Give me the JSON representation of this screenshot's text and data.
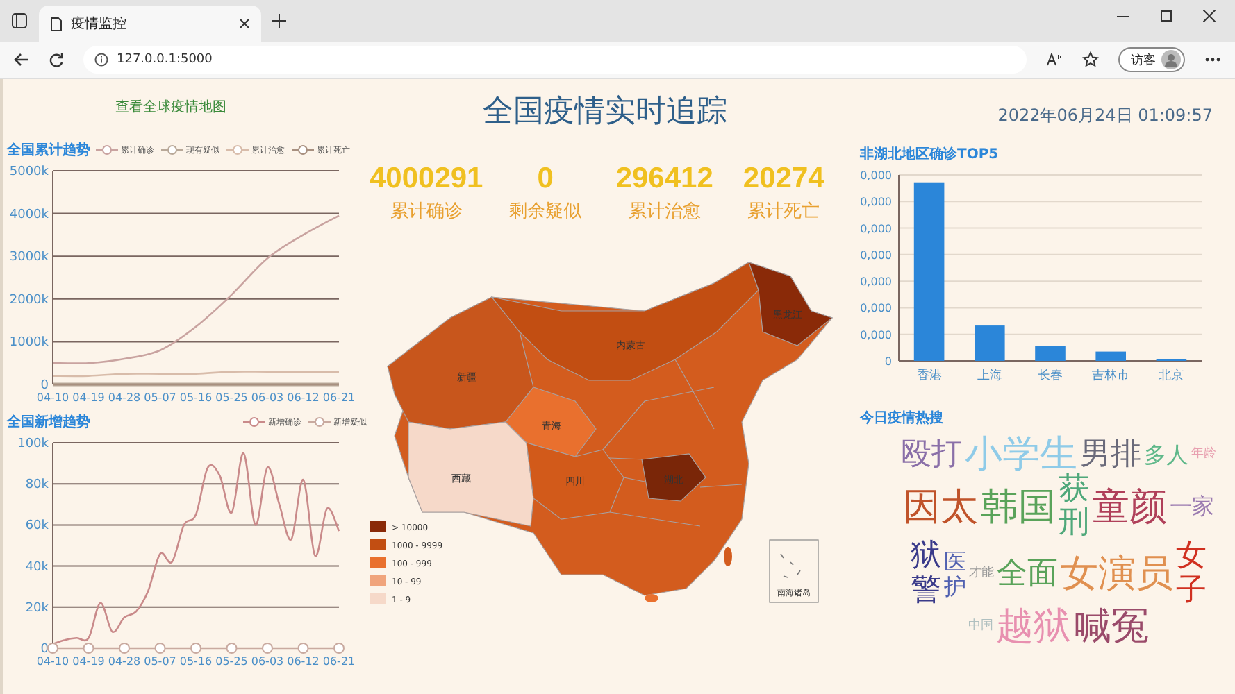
{
  "browser": {
    "tab_title": "疫情监控",
    "url": "127.0.0.1:5000",
    "profile_button": "访客"
  },
  "left": {
    "link": "查看全球疫情地图",
    "cumulative": {
      "title": "全国累计趋势",
      "chart_data": {
        "type": "line",
        "grid": true,
        "categories": [
          "04-10",
          "04-19",
          "04-28",
          "05-07",
          "05-16",
          "05-25",
          "06-03",
          "06-12",
          "06-21"
        ],
        "ylim": [
          0,
          5000
        ],
        "yticks": [
          {
            "value": 0,
            "label": "0"
          },
          {
            "value": 1000,
            "label": "1000k"
          },
          {
            "value": 2000,
            "label": "2000k"
          },
          {
            "value": 3000,
            "label": "3000k"
          },
          {
            "value": 4000,
            "label": "4000k"
          },
          {
            "value": 5000,
            "label": "5000k"
          }
        ],
        "series": [
          {
            "name": "累计确诊",
            "color": "#c9a3a0",
            "values": [
              500,
              500,
              600,
              800,
              1350,
              2100,
              2950,
              3500,
              3950
            ]
          },
          {
            "name": "现有疑似",
            "color": "#b8a898",
            "values": [
              0,
              0,
              0,
              0,
              0,
              0,
              0,
              0,
              0
            ]
          },
          {
            "name": "累计治愈",
            "color": "#d8bcaa",
            "values": [
              200,
              200,
              250,
              250,
              250,
              300,
              300,
              300,
              300
            ]
          },
          {
            "name": "累计死亡",
            "color": "#a89080",
            "values": [
              0,
              0,
              0,
              0,
              0,
              0,
              0,
              0,
              0
            ]
          }
        ]
      }
    },
    "new_cases": {
      "title": "全国新增趋势",
      "chart_data": {
        "type": "line",
        "grid": true,
        "categories": [
          "04-10",
          null,
          null,
          "04-19",
          null,
          null,
          "04-28",
          null,
          null,
          "05-07",
          null,
          null,
          "05-16",
          null,
          null,
          "05-25",
          null,
          null,
          "06-03",
          null,
          null,
          "06-12",
          null,
          null,
          "06-21"
        ],
        "ylim": [
          0,
          100
        ],
        "yticks": [
          {
            "value": 0,
            "label": "0"
          },
          {
            "value": 20,
            "label": "20k"
          },
          {
            "value": 40,
            "label": "40k"
          },
          {
            "value": 60,
            "label": "60k"
          },
          {
            "value": 80,
            "label": "80k"
          },
          {
            "value": 100,
            "label": "100k"
          }
        ],
        "series": [
          {
            "name": "新增确诊",
            "color": "#c98a8a",
            "values": [
              2,
              4,
              5,
              5,
              22,
              8,
              15,
              18,
              28,
              46,
              42,
              60,
              65,
              88,
              84,
              66,
              95,
              60,
              88,
              70,
              53,
              82,
              45,
              68,
              57
            ]
          },
          {
            "name": "新增疑似",
            "color": "#c9aaa0",
            "values": [
              0,
              0,
              0,
              0,
              0,
              0,
              0,
              0,
              0,
              0,
              0,
              0,
              0,
              0,
              0,
              0,
              0,
              0,
              0,
              0,
              0,
              0,
              0,
              0,
              0
            ]
          }
        ]
      }
    }
  },
  "center": {
    "title": "全国疫情实时追踪",
    "stats": [
      {
        "value": "4000291",
        "label": "累计确诊"
      },
      {
        "value": "0",
        "label": "剩余疑似"
      },
      {
        "value": "296412",
        "label": "累计治愈"
      },
      {
        "value": "20274",
        "label": "累计死亡"
      }
    ],
    "map": {
      "provinces": [
        {
          "name": "新疆",
          "color": "#c8561c"
        },
        {
          "name": "西藏",
          "color": "#f6d9c9"
        },
        {
          "name": "青海",
          "color": "#e9702e"
        },
        {
          "name": "内蒙古",
          "color": "#c24e12"
        },
        {
          "name": "黑龙江",
          "color": "#8a2a08"
        },
        {
          "name": "四川",
          "color": "#d25a1a"
        },
        {
          "name": "湖北",
          "color": "#7a2608"
        }
      ],
      "inset_label": "南海诸岛",
      "legend": [
        {
          "label": "> 10000",
          "color": "#8a2a08"
        },
        {
          "label": "1000 - 9999",
          "color": "#c24e12"
        },
        {
          "label": "100 - 999",
          "color": "#e9702e"
        },
        {
          "label": "10 - 99",
          "color": "#f0a47c"
        },
        {
          "label": "1 - 9",
          "color": "#f6d9c9"
        }
      ]
    }
  },
  "right": {
    "datetime": "2022年06月24日 01:09:57",
    "top5": {
      "title": "非湖北地区确诊TOP5",
      "bar_chart": {
        "y_axis_labels": [
          "0,000",
          "0,000",
          "0,000",
          "0,000",
          "0,000",
          "0,000",
          "0,000",
          "0"
        ],
        "x_axis_labels": [
          "香港",
          "上海",
          "长春",
          "吉林市",
          "北京"
        ]
      }
    },
    "hot_words": {
      "title": "今日疫情热搜",
      "words": [
        {
          "text": "殴打",
          "color": "#8a6fa8",
          "kind": "l",
          "vertical": false
        },
        {
          "text": "小学生",
          "color": "#8fcbe8",
          "kind": "xl",
          "vertical": false
        },
        {
          "text": "男排",
          "color": "#6a6a7a",
          "kind": "l",
          "vertical": false
        },
        {
          "text": "多人",
          "color": "#5fb88a",
          "kind": "m",
          "vertical": false
        },
        {
          "text": "年龄",
          "color": "#e8a0b0",
          "kind": "s",
          "vertical": false
        },
        {
          "text": "因太",
          "color": "#c0532a",
          "kind": "xl",
          "vertical": false
        },
        {
          "text": "韩国",
          "color": "#5aa35a",
          "kind": "xl",
          "vertical": false
        },
        {
          "text": "获刑",
          "color": "#4fa87a",
          "kind": "l",
          "vertical": true
        },
        {
          "text": "童颜",
          "color": "#b0405a",
          "kind": "xl",
          "vertical": false
        },
        {
          "text": "一家",
          "color": "#9a7ab0",
          "kind": "m",
          "vertical": false
        },
        {
          "text": "狱警",
          "color": "#3a3a8a",
          "kind": "l",
          "vertical": true
        },
        {
          "text": "医护",
          "color": "#5060b0",
          "kind": "m",
          "vertical": true
        },
        {
          "text": "才能",
          "color": "#999999",
          "kind": "s",
          "vertical": false
        },
        {
          "text": "全面",
          "color": "#5aa35a",
          "kind": "l",
          "vertical": false
        },
        {
          "text": "女演员",
          "color": "#e09050",
          "kind": "xl",
          "vertical": false
        },
        {
          "text": "女子",
          "color": "#d03020",
          "kind": "l",
          "vertical": true
        },
        {
          "text": "中国",
          "color": "#b0c0c0",
          "kind": "s",
          "vertical": false
        },
        {
          "text": "越狱",
          "color": "#e890b0",
          "kind": "xl",
          "vertical": false
        },
        {
          "text": "喊冤",
          "color": "#9a4a6a",
          "kind": "xl",
          "vertical": false
        }
      ]
    }
  }
}
